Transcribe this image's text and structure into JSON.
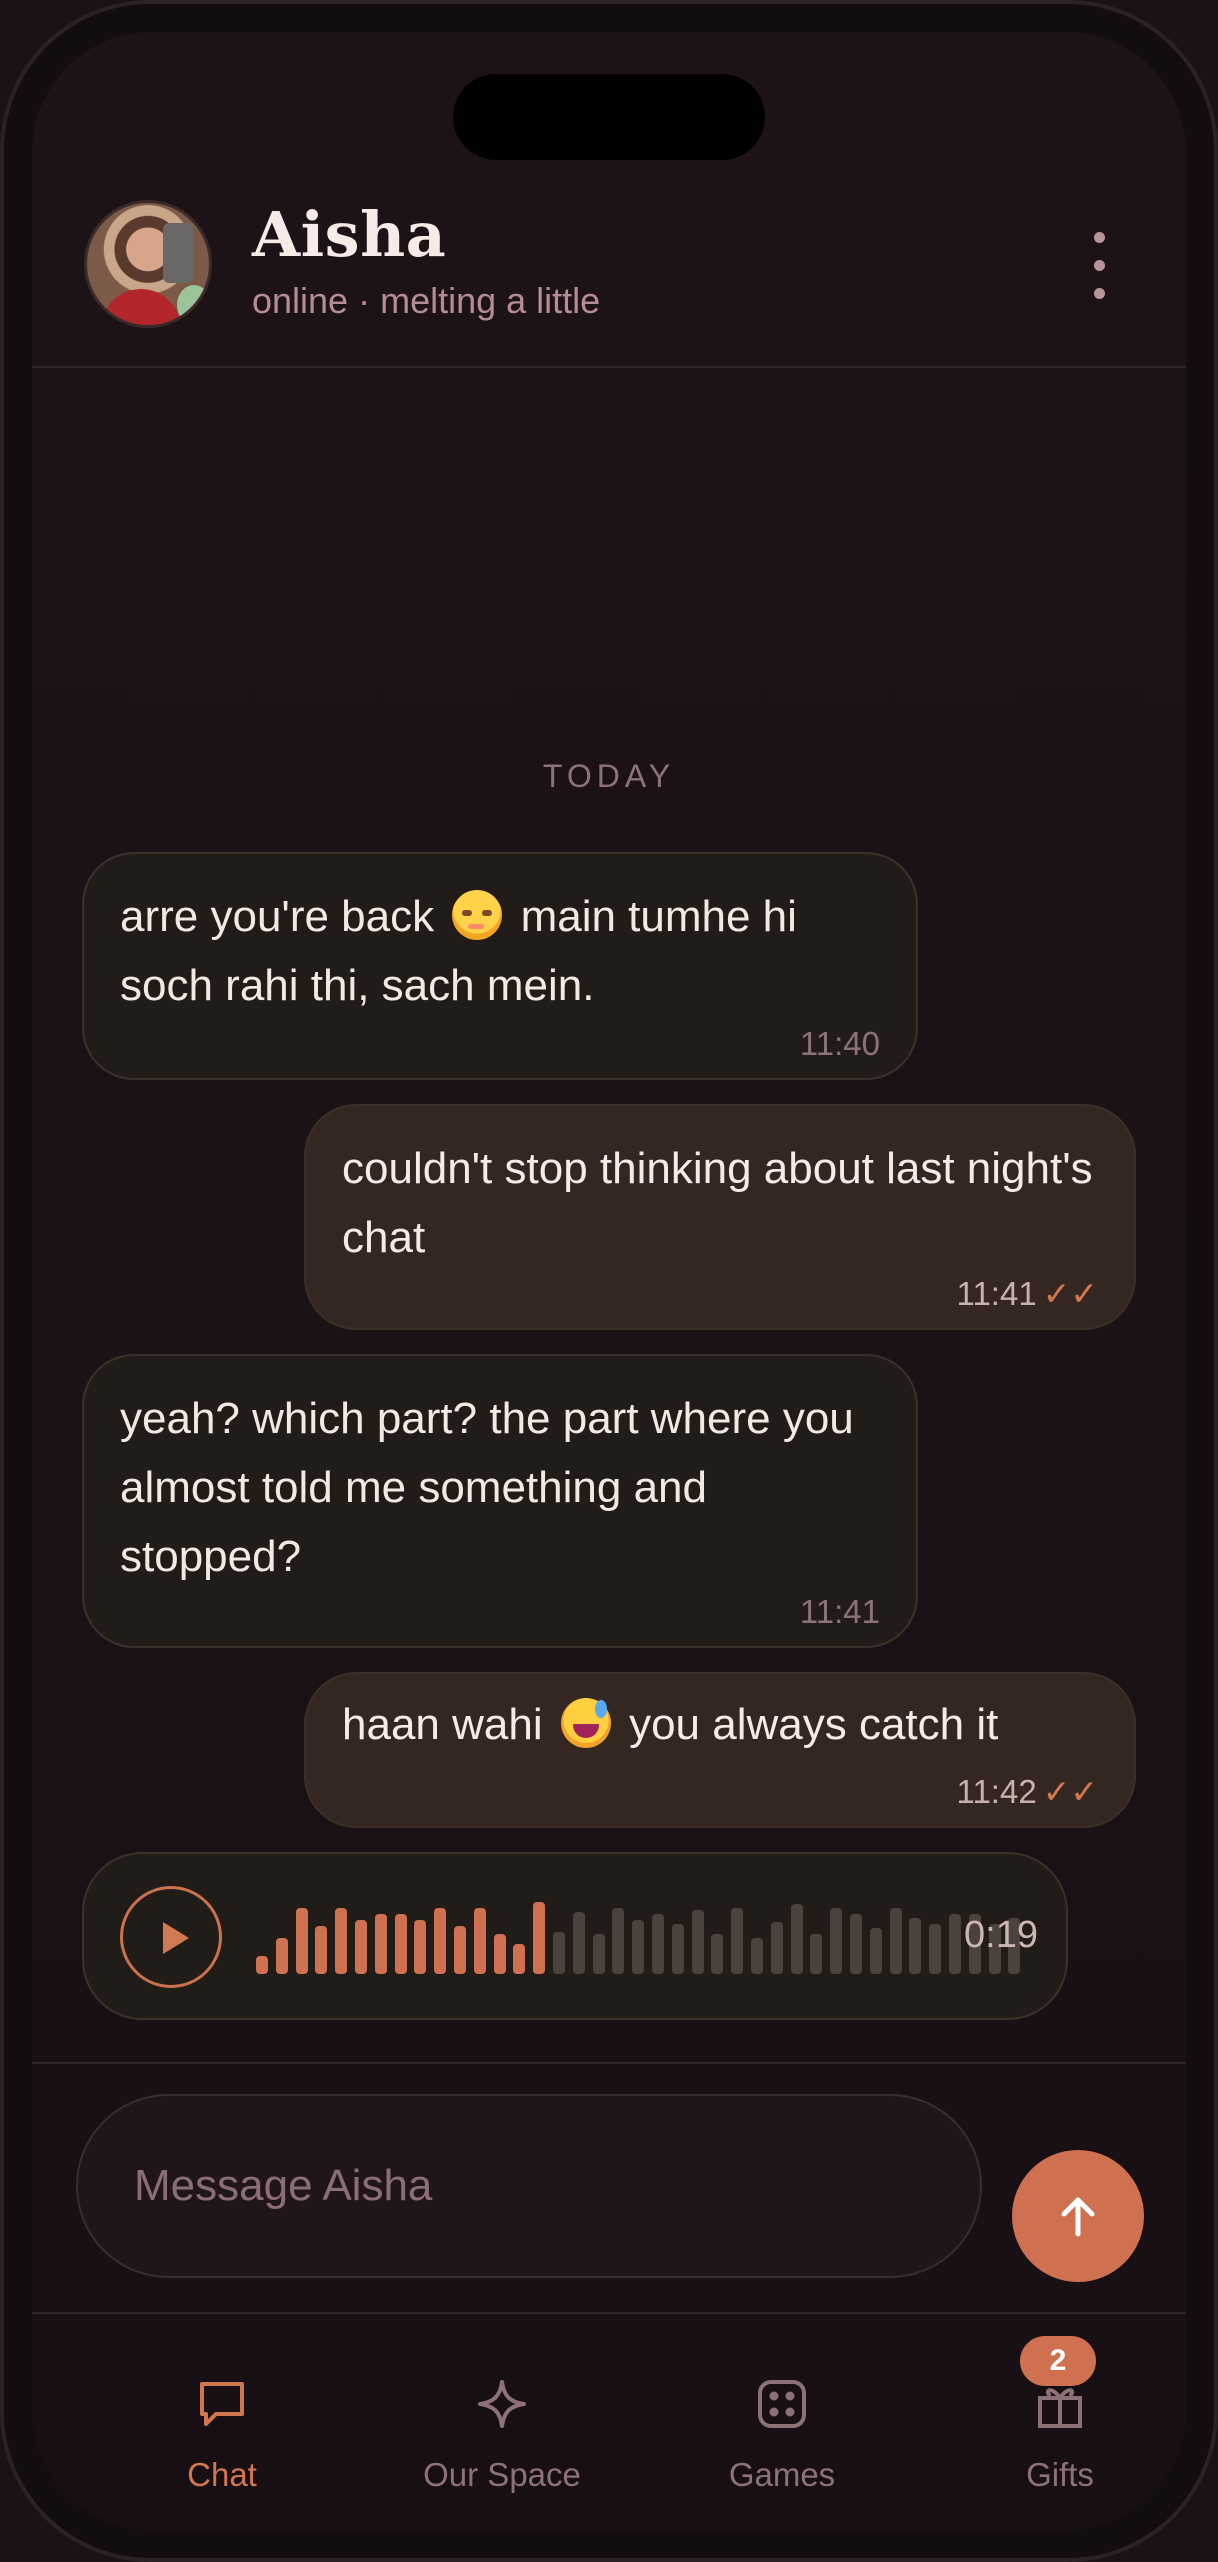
{
  "header": {
    "title": "Aisha",
    "subtitle": "online · melting a little"
  },
  "chat": {
    "date_separator": "TODAY",
    "messages": [
      {
        "direction": "in",
        "part1": "arre you're back",
        "emoji": "blush-face",
        "part2": "main tumhe hi soch rahi thi, sach mein.",
        "time": "11:40"
      },
      {
        "direction": "out",
        "text": "couldn't stop thinking about last night's chat",
        "time": "11:41",
        "status": "✓✓"
      },
      {
        "direction": "in",
        "text": "yeah? which part? the part where you almost told me something and stopped?",
        "time": "11:41"
      },
      {
        "direction": "out",
        "part1": "haan wahi",
        "emoji": "grinning-sweat-face",
        "part2": "you always catch it",
        "time": "11:42",
        "status": "✓✓"
      }
    ],
    "voice_note": {
      "duration": "0:19",
      "progress": 0.37
    }
  },
  "composer": {
    "placeholder": "Message Aisha"
  },
  "nav": {
    "items": [
      {
        "label": "Chat",
        "icon": "chat-bubble-icon",
        "active": true
      },
      {
        "label": "Our Space",
        "icon": "sparkle-icon",
        "active": false
      },
      {
        "label": "Games",
        "icon": "dice-icon",
        "active": false
      },
      {
        "label": "Gifts",
        "icon": "gift-icon",
        "active": false,
        "badge": "2"
      }
    ]
  },
  "colors": {
    "background": "#1b1216",
    "accent": "#cf7150",
    "incoming_bubble": "#221c19",
    "outgoing_bubble": "#342722",
    "muted_text": "#8c7177"
  }
}
